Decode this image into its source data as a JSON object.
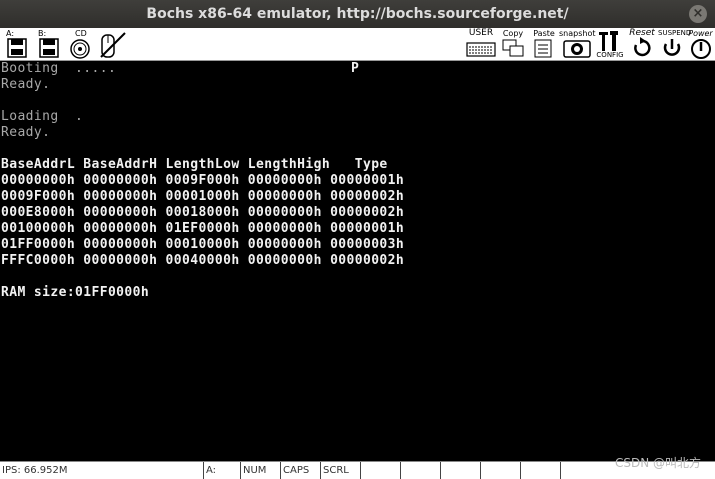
{
  "window": {
    "title": "Bochs x86-64 emulator, http://bochs.sourceforge.net/",
    "close_glyph": "×"
  },
  "toolbar": {
    "floppy_a": "A:",
    "floppy_b": "B:",
    "cdrom": "CD",
    "user": "USER",
    "copy": "Copy",
    "paste": "Paste",
    "snapshot": "snapshot",
    "config": "CONFIG",
    "reset": "Reset",
    "suspend": "SUSPEND",
    "power": "Power"
  },
  "console": {
    "lines": [
      "Booting  .....",
      "Ready.",
      "",
      "Loading  .",
      "Ready.",
      "",
      "BaseAddrL BaseAddrH LengthLow LengthHigh   Type",
      "00000000h 00000000h 0009F000h 00000000h 00000001h",
      "0009F000h 00000000h 00001000h 00000000h 00000002h",
      "000E8000h 00000000h 00018000h 00000000h 00000002h",
      "00100000h 00000000h 01EF0000h 00000000h 00000001h",
      "01FF0000h 00000000h 00010000h 00000000h 00000003h",
      "FFFC0000h 00000000h 00040000h 00000000h 00000002h",
      "",
      "RAM size:01FF0000h"
    ],
    "cursor_char": "P"
  },
  "status": {
    "ips": "IPS: 66.952M",
    "drive": "A:",
    "num": "NUM",
    "caps": "CAPS",
    "scrl": "SCRL"
  },
  "watermark": "CSDN @叫北方"
}
